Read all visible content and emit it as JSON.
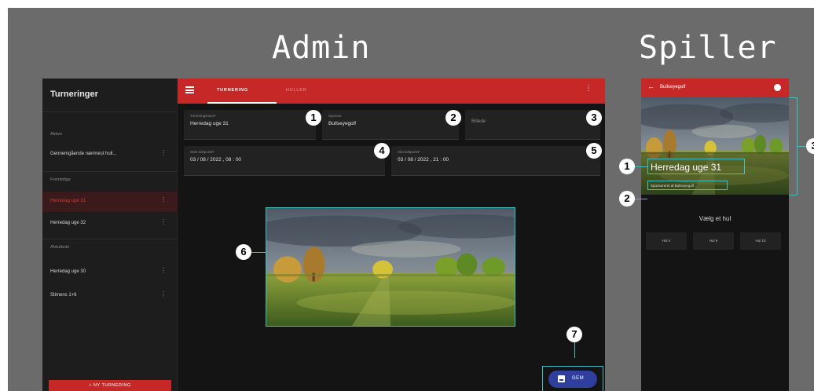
{
  "headings": {
    "admin": "Admin",
    "player": "Spiller"
  },
  "admin": {
    "sidebar": {
      "title": "Turneringer",
      "sections": [
        {
          "label": "Aktive",
          "items": [
            {
              "label": "Gennemgående nærmest hull..."
            }
          ]
        },
        {
          "label": "Fremtidige",
          "items": [
            {
              "label": "Herredag uge 31"
            },
            {
              "label": "Herredag uge 32"
            }
          ]
        },
        {
          "label": "Afsluttede",
          "items": [
            {
              "label": "Herredag uge 30"
            },
            {
              "label": "Stimens 1+6"
            }
          ]
        }
      ],
      "add_button": "+ NY TURNERING"
    },
    "tabs": [
      "TURNERING",
      "HULLER"
    ],
    "fields": {
      "name": {
        "label": "Turneringsnavn*",
        "value": "Herredag uge 31"
      },
      "sponsor": {
        "label": "Sponsor",
        "value": "Bullseyegolf"
      },
      "image": {
        "placeholder": "Billede"
      },
      "start": {
        "label": "Start tidspunkt*",
        "value": "03 / 08 / 2022 , 08 : 00"
      },
      "end": {
        "label": "Slut tidspunkt*",
        "value": "03 / 08 / 2022 , 21 : 00"
      }
    },
    "save_button": "GEM"
  },
  "player": {
    "appbar_title": "Bullseyegolf",
    "tournament_name": "Herredag uge 31",
    "sponsor_line": "Sponsoreret af Bullseyegolf",
    "choose_hole": "Vælg et hul",
    "holes": [
      "Hul 4",
      "Hul 8",
      "Hul 10"
    ]
  },
  "callouts": [
    "1",
    "2",
    "3",
    "4",
    "5",
    "6",
    "7"
  ],
  "colors": {
    "background": "#6b6b6b",
    "appbar": "#c62828",
    "highlight": "#3fc1c1",
    "save_button": "#303f9f"
  },
  "icons": [
    "menu-icon",
    "more-vert-icon",
    "arrow-back-icon",
    "save-icon",
    "avatar-dot-icon"
  ]
}
